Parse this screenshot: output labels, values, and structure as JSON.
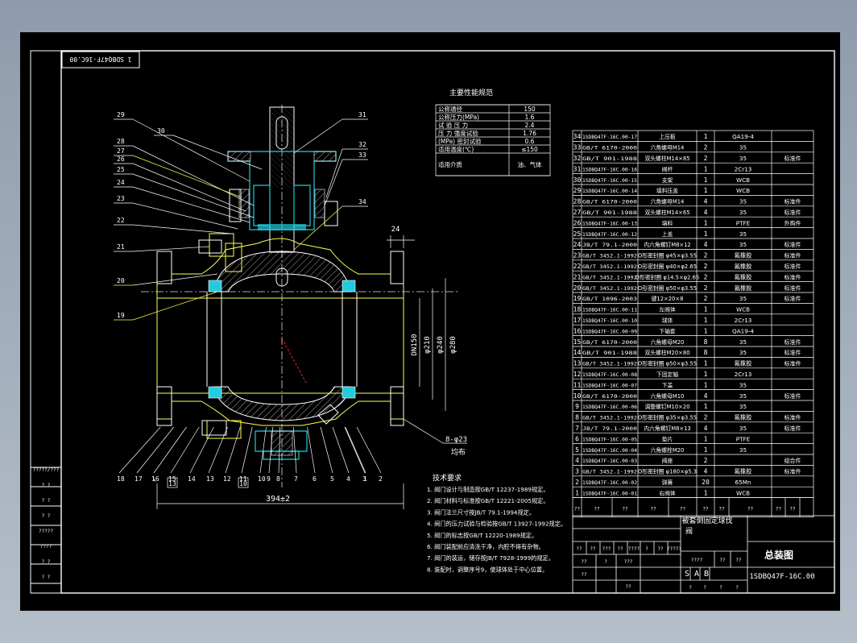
{
  "drawing": {
    "title": "总装图",
    "drawing_no": "1SDBQ47F-16C.00",
    "rotated_code": "1 SDBQ47F-16C.00",
    "product_name_line1": "被套倒固定球伐",
    "product_name_line2": "阀",
    "scale_marks": [
      "S",
      "A",
      "B"
    ]
  },
  "performance": {
    "title": "主要性能规范",
    "rows": [
      [
        "公称通径",
        "150"
      ],
      [
        "公称压力(MPa)",
        "1.6"
      ],
      [
        "试 验 压 力",
        "2.4"
      ],
      [
        "压 力 强度试验",
        "1.76"
      ],
      [
        "(MPa) 密封试验",
        "0.6"
      ],
      [
        "适用温度(℃)",
        "≤150"
      ],
      [
        "适用介质",
        "油、气体"
      ]
    ]
  },
  "tech": {
    "title": "技术要求",
    "items": [
      "1. 阀门设计与制造按GB/T 12237-1989规定。",
      "2. 阀门材料与标准按GB/T 12221-2005规定。",
      "3. 阀门法兰尺寸按JB/T 79.1-1994规定。",
      "4. 阀门的压力试验与检验按GB/T 13927-1992规定。",
      "5. 阀门的标志按GB/T 12220-1989规定。",
      "6. 阀门装配前应清洗干净，内腔不得有杂物。",
      "7. 阀门的装运，储存按JB/T 7928-1999的规定。",
      "8. 装配时，调整序号9，使球体处于中心位置。"
    ]
  },
  "dimensions": {
    "dn": "DN150",
    "d1": "φ210",
    "d2": "φ240",
    "d3": "φ280",
    "length": "394±2",
    "flange": "24",
    "holes": "8-φ23",
    "holes_note": "均布"
  },
  "callouts": {
    "left": [
      "29",
      "30",
      "28",
      "27",
      "26",
      "25",
      "24",
      "23",
      "22",
      "21",
      "20",
      "19"
    ],
    "right": [
      "31",
      "32",
      "33",
      "34"
    ],
    "bottom": [
      "18",
      "17",
      "16",
      "15",
      "14",
      "13",
      "12",
      "11",
      "10",
      "9",
      "8",
      "7",
      "6",
      "5",
      "4",
      "3",
      "2",
      "1"
    ]
  },
  "bom": [
    [
      "34",
      "1SDBQ47F-16C.00-17",
      "上压板",
      "1",
      "QA19-4",
      ""
    ],
    [
      "33",
      "GB/T 6170-2000",
      "六角螺母M14",
      "2",
      "35",
      ""
    ],
    [
      "32",
      "GB/T 901-1988",
      "双头螺柱M14×85",
      "2",
      "35",
      "标准件"
    ],
    [
      "31",
      "1SDBQ47F-16C.00-16",
      "阀杆",
      "1",
      "2Cr13",
      ""
    ],
    [
      "30",
      "1SDBQ47F-16C.00-15",
      "支架",
      "1",
      "WCB",
      ""
    ],
    [
      "29",
      "1SDBQ47F-16C.00-14",
      "填料压盖",
      "1",
      "WCB",
      ""
    ],
    [
      "28",
      "GB/T 6170-2000",
      "六角螺母M14",
      "4",
      "35",
      "标准件"
    ],
    [
      "27",
      "GB/T 901-1988",
      "双头螺柱M14×65",
      "4",
      "35",
      "标准件"
    ],
    [
      "26",
      "1SDBQ47F-16C.00-13",
      "填料",
      "1",
      "PTFE",
      "外购件"
    ],
    [
      "25",
      "1SDBQ47F-16C.00-12",
      "上盖",
      "1",
      "35",
      ""
    ],
    [
      "24",
      "JB/T 79.1-2000",
      "内六角螺钉M8×12",
      "4",
      "35",
      "标准件"
    ],
    [
      "23",
      "GB/T 3452.1-1992",
      "O形密封圈 φ45×φ3.55",
      "2",
      "氟橡胶",
      "标准件"
    ],
    [
      "22",
      "GB/T 3452.1-1992",
      "O形密封圈 φ40×φ2.65",
      "2",
      "氟橡胶",
      "标准件"
    ],
    [
      "21",
      "GB/T 3452.1-1992",
      "O形密封圈 φ14.5×φ2.65",
      "2",
      "氟橡胶",
      "标准件"
    ],
    [
      "20",
      "GB/T 3452.1-1992",
      "O形密封圈 φ50×φ3.55",
      "2",
      "氟橡胶",
      "标准件"
    ],
    [
      "19",
      "GB/T 1096-2003",
      "键12×20×8",
      "2",
      "35",
      "标准件"
    ],
    [
      "18",
      "1SDBQ47F-16C.00-11",
      "左阀体",
      "1",
      "WCB",
      ""
    ],
    [
      "17",
      "1SDBQ47F-16C.00-10",
      "球体",
      "1",
      "2Cr13",
      ""
    ],
    [
      "16",
      "1SDBQ47F-16C.00-09",
      "下轴套",
      "1",
      "QA19-4",
      ""
    ],
    [
      "15",
      "GB/T 6170-2000",
      "六角螺母M20",
      "8",
      "35",
      "标准件"
    ],
    [
      "14",
      "GB/T 901-1988",
      "双头螺柱M20×80",
      "8",
      "35",
      "标准件"
    ],
    [
      "13",
      "GB/T 3452.1-1992",
      "O形密封圈 φ50×φ3.55",
      "1",
      "氟橡胶",
      "标准件"
    ],
    [
      "12",
      "1SDBQ47F-16C.00-08",
      "下固定轴",
      "1",
      "2Cr13",
      ""
    ],
    [
      "11",
      "1SDBQ47F-16C.00-07",
      "下盖",
      "1",
      "35",
      ""
    ],
    [
      "10",
      "GB/T 6170-2000",
      "六角螺母M10",
      "4",
      "35",
      "标准件"
    ],
    [
      "9",
      "1SDBQ47F-16C.00-06",
      "调整螺钉M10×20",
      "1",
      "35",
      ""
    ],
    [
      "8",
      "GB/T 3452.1-1992",
      "O形密封圈 φ35×φ3.55",
      "2",
      "氟橡胶",
      "标准件"
    ],
    [
      "7",
      "JB/T 79.1-2000",
      "内六角螺钉M8×13",
      "4",
      "35",
      "标准件"
    ],
    [
      "6",
      "1SDBQ47F-16C.00-05",
      "垫片",
      "1",
      "PTFE",
      ""
    ],
    [
      "5",
      "1SDBQ47F-16C.00-04",
      "六角螺栓M20",
      "1",
      "35",
      ""
    ],
    [
      "4",
      "1SDBQ47F-16C.00-03",
      "阀座",
      "2",
      "",
      "组合件"
    ],
    [
      "3",
      "GB/T 3452.1-1992",
      "O形密封圈 φ180×φ5.3",
      "4",
      "氟橡胶",
      "标准件"
    ],
    [
      "2",
      "1SDBQ47F-16C.00-02",
      "弹簧",
      "20",
      "65Mn",
      ""
    ],
    [
      "1",
      "1SDBQ47F-16C.00-01",
      "右阀体",
      "1",
      "WCB",
      ""
    ]
  ],
  "bom_header": [
    "??",
    "??",
    "??",
    "??",
    "??",
    "??",
    "??",
    "??",
    "??",
    "??"
  ],
  "left_strip": [
    "?????/???",
    "? ?",
    "? ?",
    "? ?",
    "?????",
    "????",
    "? ?",
    "? ?"
  ],
  "titleblock": {
    "r1": [
      "??",
      "??",
      "???",
      "??",
      "????",
      "?",
      "??",
      "?????"
    ],
    "r2": [
      "??",
      "?",
      "???"
    ],
    "r3": [
      "????",
      "??",
      "??"
    ],
    "r4": [
      "??",
      "??"
    ],
    "r5": [
      "?",
      "?",
      "?",
      "?"
    ]
  }
}
